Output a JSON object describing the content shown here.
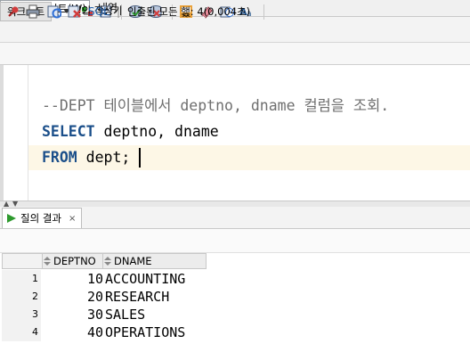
{
  "top_tabs": {
    "worksheet": "SQL 워크시트(W)",
    "history": "내역"
  },
  "toolbar": {
    "icons": [
      "run-statement-icon",
      "run-script-icon",
      "autotrace-icon",
      "dropdown-arrow-icon",
      "explain-plan-icon",
      "sql-tuning-icon",
      "commit-icon",
      "rollback-icon",
      "sql-format-icon",
      "clear-icon",
      "history-icon",
      "case-change-icon"
    ]
  },
  "sub_tabs": {
    "worksheet": "워크시트",
    "query_builder": "질의 작성기"
  },
  "editor": {
    "line1": "--DEPT 테이블에서 deptno, dname 컬럼을 조회.",
    "line2_kw": "SELECT",
    "line2_rest": " deptno, dname",
    "line3_kw": "FROM",
    "line3_rest": " dept;"
  },
  "result_tab": {
    "label": "질의 결과",
    "close": "×"
  },
  "result_toolbar": {
    "sql_label": "SQL",
    "separator": "|",
    "status": "인출된 모든 행: 4(0,004초)"
  },
  "grid": {
    "columns": [
      "DEPTNO",
      "DNAME"
    ],
    "rows": [
      {
        "n": "1",
        "deptno": "10",
        "dname": "ACCOUNTING"
      },
      {
        "n": "2",
        "deptno": "20",
        "dname": "RESEARCH"
      },
      {
        "n": "3",
        "deptno": "30",
        "dname": "SALES"
      },
      {
        "n": "4",
        "deptno": "40",
        "dname": "OPERATIONS"
      }
    ]
  },
  "colors": {
    "keyword": "#1b4f8a",
    "comment": "#6f6f6f",
    "current_line": "#fdf7e6",
    "run_green": "#2e9a2e"
  }
}
